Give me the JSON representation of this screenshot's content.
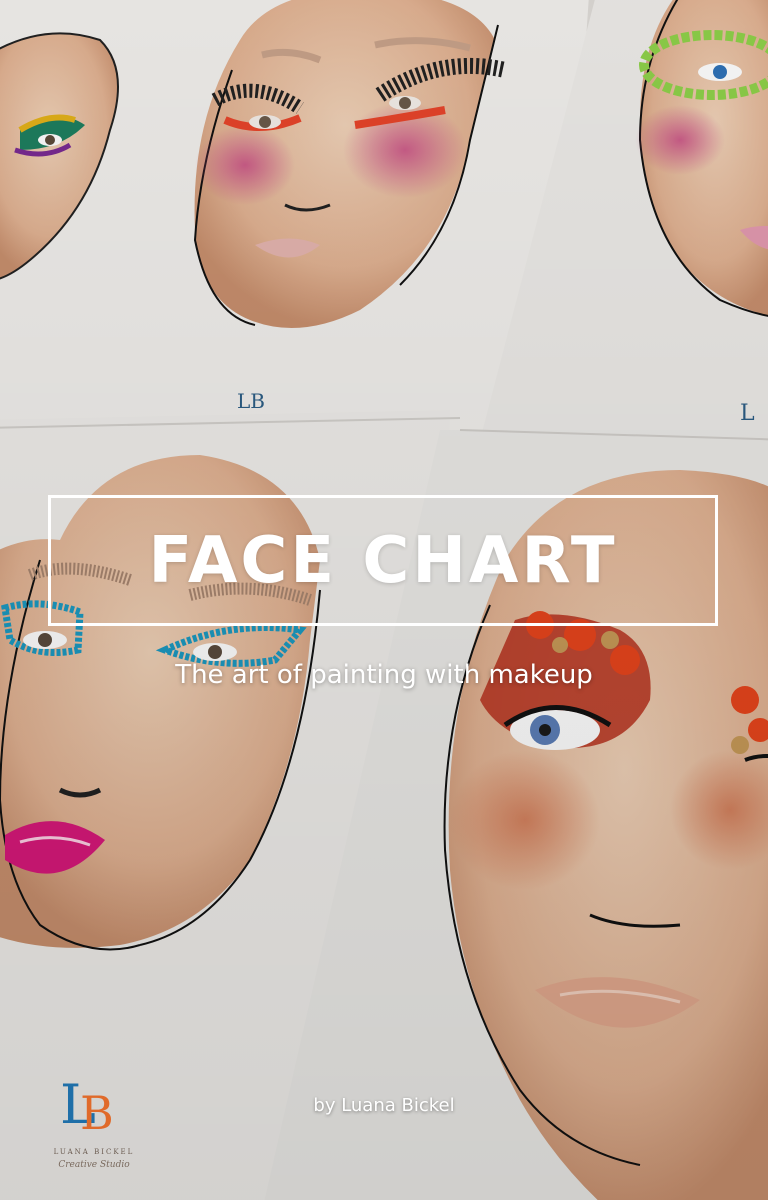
{
  "cover": {
    "title": "FACE CHART",
    "subtitle": "The art of painting with makeup",
    "author": "by Luana Bickel"
  },
  "logo": {
    "letters": [
      "L",
      "B"
    ],
    "name": "LUANA BICKEL",
    "tagline": "Creative Studio"
  },
  "colors": {
    "text": "#ffffff",
    "logo_blue": "#1f6fa8",
    "logo_orange": "#e06a2a",
    "paper": "#f1efec",
    "skin": "#e7bfa0"
  }
}
